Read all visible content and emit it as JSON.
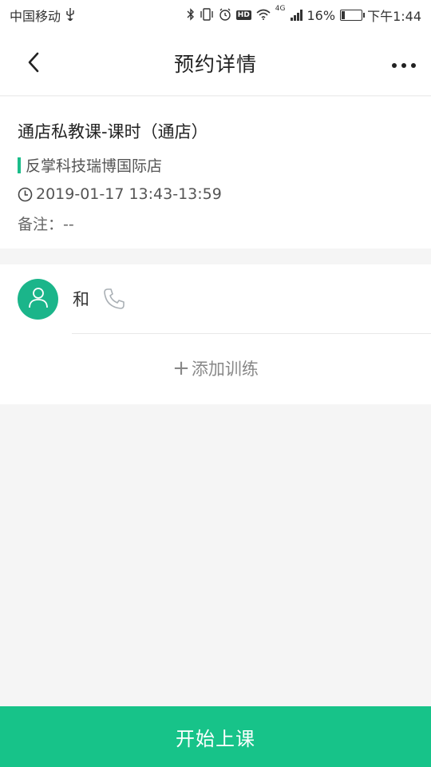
{
  "status_bar": {
    "carrier": "中国移动",
    "network": "4G",
    "battery": "16%",
    "battery_level": 0.16,
    "time": "下午1:44"
  },
  "nav": {
    "title": "预约详情",
    "back_icon": "chevron-left-icon",
    "more_icon": "more-dots-icon"
  },
  "booking": {
    "course_title": "通店私教课-课时（通店）",
    "store": "反掌科技瑞博国际店",
    "time": "2019-01-17 13:43-13:59",
    "remark": "备注：--"
  },
  "member": {
    "name": "和",
    "avatar_icon": "user-icon",
    "phone_icon": "phone-icon"
  },
  "add_training": {
    "plus": "+",
    "label": "添加训练"
  },
  "bottom": {
    "start_label": "开始上课"
  },
  "colors": {
    "accent": "#17c389",
    "avatar_bg": "#1bb58a",
    "store_bar": "#1bbd8a"
  }
}
